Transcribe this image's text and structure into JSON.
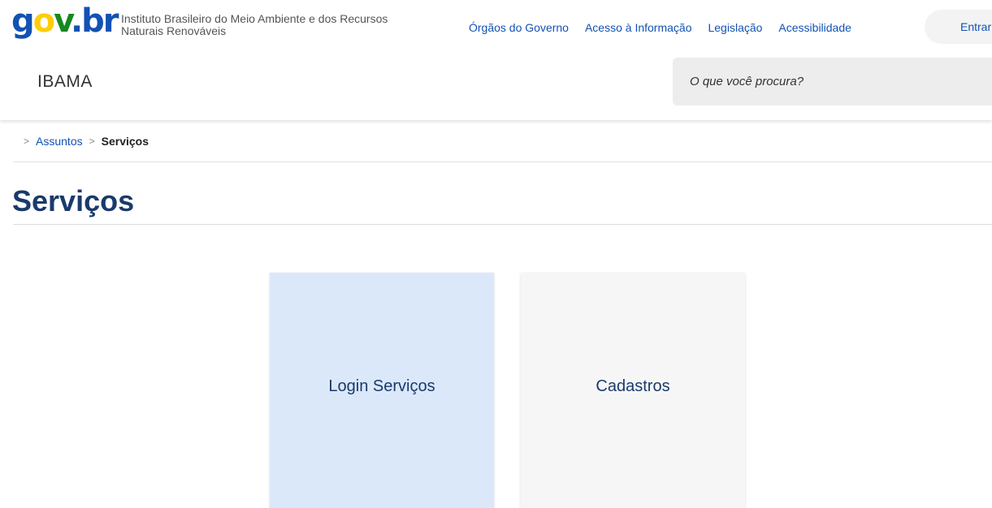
{
  "header": {
    "logo": {
      "part1": "g",
      "part2": "o",
      "part3": "v",
      "part4": ".",
      "part5": "br"
    },
    "org_name": "Instituto Brasileiro do Meio Ambiente e dos Recursos Naturais Renováveis",
    "nav": [
      "Órgãos do Governo",
      "Acesso à Informação",
      "Legislação",
      "Acessibilidade"
    ],
    "login_label": "Entrar",
    "site_name": "IBAMA",
    "search_placeholder": "O que você procura?"
  },
  "breadcrumb": {
    "items": [
      "Assuntos"
    ],
    "current": "Serviços",
    "separator": ">"
  },
  "page": {
    "title": "Serviços"
  },
  "cards": [
    {
      "label": "Login Serviços"
    },
    {
      "label": "Cadastros"
    }
  ],
  "colors": {
    "brand_blue": "#1351b4",
    "brand_yellow": "#ffcd07",
    "brand_green": "#168821",
    "title_navy": "#1a3a6b",
    "card_active": "#dbe8f9",
    "card_default": "#f6f6f6"
  }
}
